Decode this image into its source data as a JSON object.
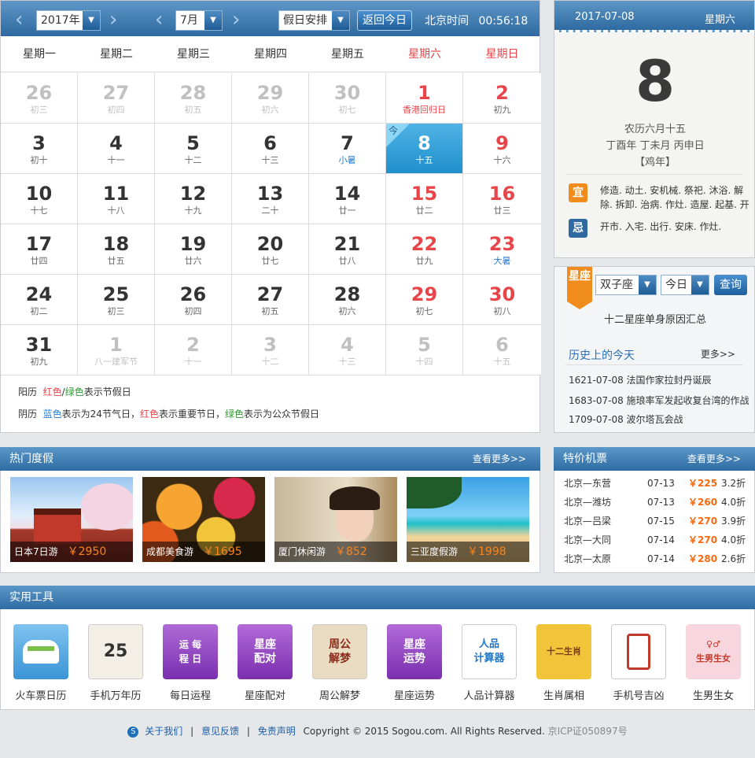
{
  "calendar": {
    "year_label": "2017年",
    "month_label": "7月",
    "holiday_select": "假日安排",
    "today_button": "返回今日",
    "time_label": "北京时间",
    "time_value": "00:56:18",
    "today_tag": "今",
    "weekdays": [
      "星期一",
      "星期二",
      "星期三",
      "星期四",
      "星期五",
      "星期六",
      "星期日"
    ],
    "days": [
      {
        "d": "26",
        "l": "初三",
        "t": "other"
      },
      {
        "d": "27",
        "l": "初四",
        "t": "other"
      },
      {
        "d": "28",
        "l": "初五",
        "t": "other"
      },
      {
        "d": "29",
        "l": "初六",
        "t": "other"
      },
      {
        "d": "30",
        "l": "初七",
        "t": "other"
      },
      {
        "d": "1",
        "l": "香港回归日",
        "t": "holiday",
        "lc": "red"
      },
      {
        "d": "2",
        "l": "初九",
        "t": "weekend"
      },
      {
        "d": "3",
        "l": "初十"
      },
      {
        "d": "4",
        "l": "十一"
      },
      {
        "d": "5",
        "l": "十二"
      },
      {
        "d": "6",
        "l": "十三"
      },
      {
        "d": "7",
        "l": "小暑",
        "lc": "blue"
      },
      {
        "d": "8",
        "l": "十五",
        "t": "sel"
      },
      {
        "d": "9",
        "l": "十六",
        "t": "weekend"
      },
      {
        "d": "10",
        "l": "十七"
      },
      {
        "d": "11",
        "l": "十八"
      },
      {
        "d": "12",
        "l": "十九"
      },
      {
        "d": "13",
        "l": "二十"
      },
      {
        "d": "14",
        "l": "廿一"
      },
      {
        "d": "15",
        "l": "廿二",
        "t": "weekend"
      },
      {
        "d": "16",
        "l": "廿三",
        "t": "weekend"
      },
      {
        "d": "17",
        "l": "廿四"
      },
      {
        "d": "18",
        "l": "廿五"
      },
      {
        "d": "19",
        "l": "廿六"
      },
      {
        "d": "20",
        "l": "廿七"
      },
      {
        "d": "21",
        "l": "廿八"
      },
      {
        "d": "22",
        "l": "廿九",
        "t": "weekend"
      },
      {
        "d": "23",
        "l": "大暑",
        "t": "weekend",
        "lc": "blue"
      },
      {
        "d": "24",
        "l": "初二"
      },
      {
        "d": "25",
        "l": "初三"
      },
      {
        "d": "26",
        "l": "初四"
      },
      {
        "d": "27",
        "l": "初五"
      },
      {
        "d": "28",
        "l": "初六"
      },
      {
        "d": "29",
        "l": "初七",
        "t": "weekend"
      },
      {
        "d": "30",
        "l": "初八",
        "t": "weekend"
      },
      {
        "d": "31",
        "l": "初九"
      },
      {
        "d": "1",
        "l": "八一建军节",
        "t": "other"
      },
      {
        "d": "2",
        "l": "十一",
        "t": "other"
      },
      {
        "d": "3",
        "l": "十二",
        "t": "other"
      },
      {
        "d": "4",
        "l": "十三",
        "t": "other"
      },
      {
        "d": "5",
        "l": "十四",
        "t": "other"
      },
      {
        "d": "6",
        "l": "十五",
        "t": "other"
      }
    ],
    "legend1": {
      "prefix": "阳历",
      "red": "红色",
      "slash": "/",
      "green": "绿色",
      "suffix": "表示节假日"
    },
    "legend2": {
      "prefix": "阴历",
      "blue": "蓝色",
      "t1": "表示为24节气日，",
      "red": "红色",
      "t2": "表示重要节日，",
      "green": "绿色",
      "t3": "表示为公众节假日"
    }
  },
  "daycard": {
    "date": "2017-07-08",
    "weekday": "星期六",
    "day_number": "8",
    "lunar_date": "农历六月十五",
    "ganzhi": "丁酉年  丁未月  丙申日",
    "zodiac": "【鸡年】",
    "yi_label": "宜",
    "yi_text": "修造. 动土. 安机械. 祭祀. 沐浴. 解除. 拆卸. 治病. 作灶. 造屋. 起基. 开",
    "ji_label": "忌",
    "ji_text": "开市. 入宅. 出行. 安床. 作灶."
  },
  "star": {
    "ribbon": "星座",
    "sign_select": "双子座",
    "period_select": "今日",
    "query_button": "查询",
    "headline": "十二星座单身原因汇总",
    "history_title": "历史上的今天",
    "history_more": "更多>>",
    "history": [
      "1621-07-08 法国作家拉封丹诞辰",
      "1683-07-08 施琅率军发起收复台湾的作战",
      "1709-07-08 波尔塔瓦会战"
    ]
  },
  "hot": {
    "title": "热门度假",
    "more": "查看更多>>",
    "items": [
      {
        "name": "日本7日游",
        "price": "￥2950"
      },
      {
        "name": "成都美食游",
        "price": "￥1695"
      },
      {
        "name": "厦门休闲游",
        "price": "￥852"
      },
      {
        "name": "三亚度假游",
        "price": "￥1998"
      }
    ]
  },
  "tickets": {
    "title": "特价机票",
    "more": "查看更多>>",
    "rows": [
      {
        "route": "北京—东营",
        "date": "07-13",
        "price": "￥225",
        "disc": "3.2折"
      },
      {
        "route": "北京—潍坊",
        "date": "07-13",
        "price": "￥260",
        "disc": "4.0折"
      },
      {
        "route": "北京—吕梁",
        "date": "07-15",
        "price": "￥270",
        "disc": "3.9折"
      },
      {
        "route": "北京—大同",
        "date": "07-14",
        "price": "￥270",
        "disc": "4.0折"
      },
      {
        "route": "北京—太原",
        "date": "07-14",
        "price": "￥280",
        "disc": "2.6折"
      }
    ]
  },
  "tools": {
    "title": "实用工具",
    "items": [
      {
        "name": "火车票日历",
        "icon": "train-calendar-icon",
        "art": ""
      },
      {
        "name": "手机万年历",
        "icon": "calendar-25-icon",
        "art": "25"
      },
      {
        "name": "每日运程",
        "icon": "yinyang-icon",
        "art": "运 每\n程 日"
      },
      {
        "name": "星座配对",
        "icon": "star-match-icon",
        "art": "星座\n配对"
      },
      {
        "name": "周公解梦",
        "icon": "dream-icon",
        "art": "周公\n解梦"
      },
      {
        "name": "星座运势",
        "icon": "star-fortune-icon",
        "art": "星座\n运势"
      },
      {
        "name": "人品计算器",
        "icon": "calculator-icon",
        "art": "人品\n计算器"
      },
      {
        "name": "生肖属相",
        "icon": "zodiac-animal-icon",
        "art": "十二生肖"
      },
      {
        "name": "手机号吉凶",
        "icon": "phone-search-icon",
        "art": ""
      },
      {
        "name": "生男生女",
        "icon": "gender-icon",
        "art": "♀♂\n生男生女"
      }
    ]
  },
  "footer": {
    "about": "关于我们",
    "feedback": "意见反馈",
    "disclaimer": "免责声明",
    "sep": "|",
    "copyright": "Copyright © 2015 Sogou.com. All Rights Reserved.",
    "icp": "京ICP证050897号"
  },
  "colors": {
    "brand_blue": "#2e6aa0",
    "weekend_red": "#e8454a",
    "term_blue": "#2a7fd4",
    "price_orange": "#f26a10"
  }
}
